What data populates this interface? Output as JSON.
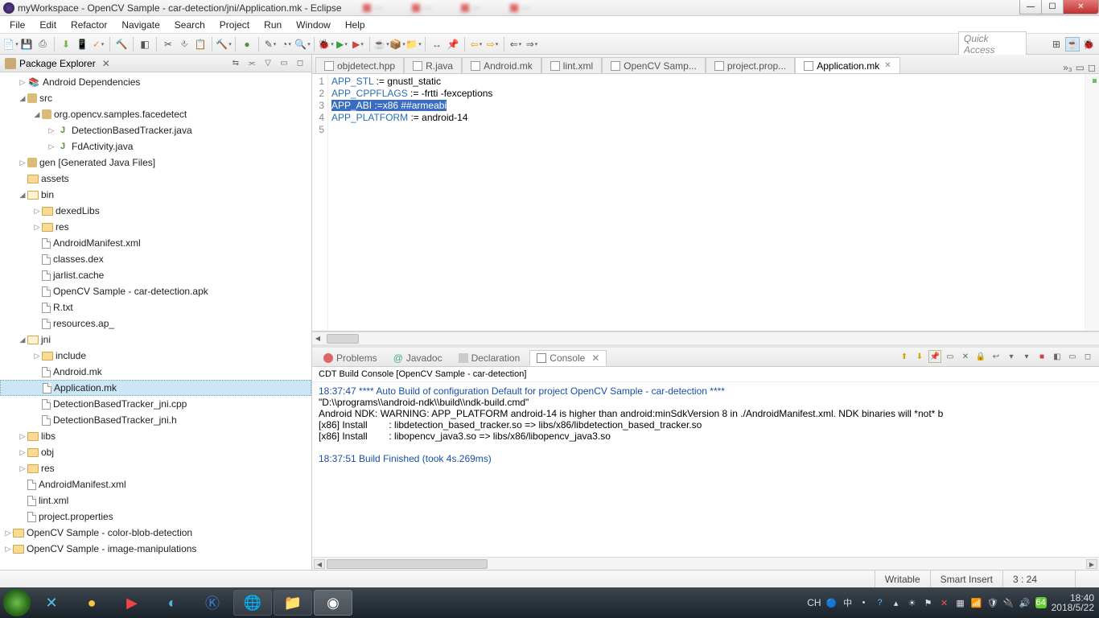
{
  "window": {
    "title": "myWorkspace - OpenCV Sample - car-detection/jni/Application.mk - Eclipse"
  },
  "menu": {
    "file": "File",
    "edit": "Edit",
    "refactor": "Refactor",
    "navigate": "Navigate",
    "search": "Search",
    "project": "Project",
    "run": "Run",
    "window": "Window",
    "help": "Help"
  },
  "toolbar": {
    "quick_access": "Quick Access"
  },
  "package_explorer": {
    "title": "Package Explorer",
    "nodes": {
      "android_deps": "Android Dependencies",
      "src": "src",
      "pkg": "org.opencv.samples.facedetect",
      "dbt": "DetectionBasedTracker.java",
      "fda": "FdActivity.java",
      "gen": "gen",
      "gen_suffix": "[Generated Java Files]",
      "assets": "assets",
      "bin": "bin",
      "dexed": "dexedLibs",
      "res_bin": "res",
      "am_bin": "AndroidManifest.xml",
      "classes": "classes.dex",
      "jarlist": "jarlist.cache",
      "apk": "OpenCV Sample - car-detection.apk",
      "rtxt": "R.txt",
      "resap": "resources.ap_",
      "jni": "jni",
      "include": "include",
      "androidmk": "Android.mk",
      "appmk": "Application.mk",
      "dbtcpp": "DetectionBasedTracker_jni.cpp",
      "dbth": "DetectionBasedTracker_jni.h",
      "libs": "libs",
      "obj": "obj",
      "res": "res",
      "am": "AndroidManifest.xml",
      "lint": "lint.xml",
      "projprop": "project.properties",
      "colorblob": "OpenCV Sample - color-blob-detection",
      "imgmanip": "OpenCV Sample - image-manipulations"
    }
  },
  "editor": {
    "tabs": {
      "objdetect": "objdetect.hpp",
      "rjava": "R.java",
      "androidmk": "Android.mk",
      "lintxml": "lint.xml",
      "opencvsamp": "OpenCV Samp...",
      "projprop": "project.prop...",
      "appmk": "Application.mk",
      "more": "»₃"
    },
    "code": {
      "l1_a": "APP_STL",
      "l1_b": " := gnustl_static",
      "l2_a": "APP_CPPFLAGS",
      "l2_b": " := -frtti -fexceptions",
      "l3": "APP_ABI :=x86 ##armeabi",
      "l4_a": "APP_PLATFORM",
      "l4_b": " := android-14",
      "ln1": "1",
      "ln2": "2",
      "ln3": "3",
      "ln4": "4",
      "ln5": "5"
    }
  },
  "bottom": {
    "tabs": {
      "problems": "Problems",
      "javadoc": "Javadoc",
      "declaration": "Declaration",
      "console": "Console"
    },
    "console_title": "CDT Build Console [OpenCV Sample - car-detection]",
    "lines": {
      "a": "18:37:47 **** Auto Build of configuration Default for project OpenCV Sample - car-detection ****",
      "b": "\"D:\\\\programs\\\\android-ndk\\\\build\\\\ndk-build.cmd\"",
      "c": "Android NDK: WARNING: APP_PLATFORM android-14 is higher than android:minSdkVersion 8 in ./AndroidManifest.xml. NDK binaries will *not* b",
      "d": "[x86] Install        : libdetection_based_tracker.so => libs/x86/libdetection_based_tracker.so",
      "e": "[x86] Install        : libopencv_java3.so => libs/x86/libopencv_java3.so",
      "f": "18:37:51 Build Finished (took 4s.269ms)"
    }
  },
  "status": {
    "writable": "Writable",
    "insert": "Smart Insert",
    "pos": "3 : 24"
  },
  "taskbar": {
    "ime": "CH",
    "time": "18:40",
    "date": "2018/5/22",
    "badge": "64"
  }
}
